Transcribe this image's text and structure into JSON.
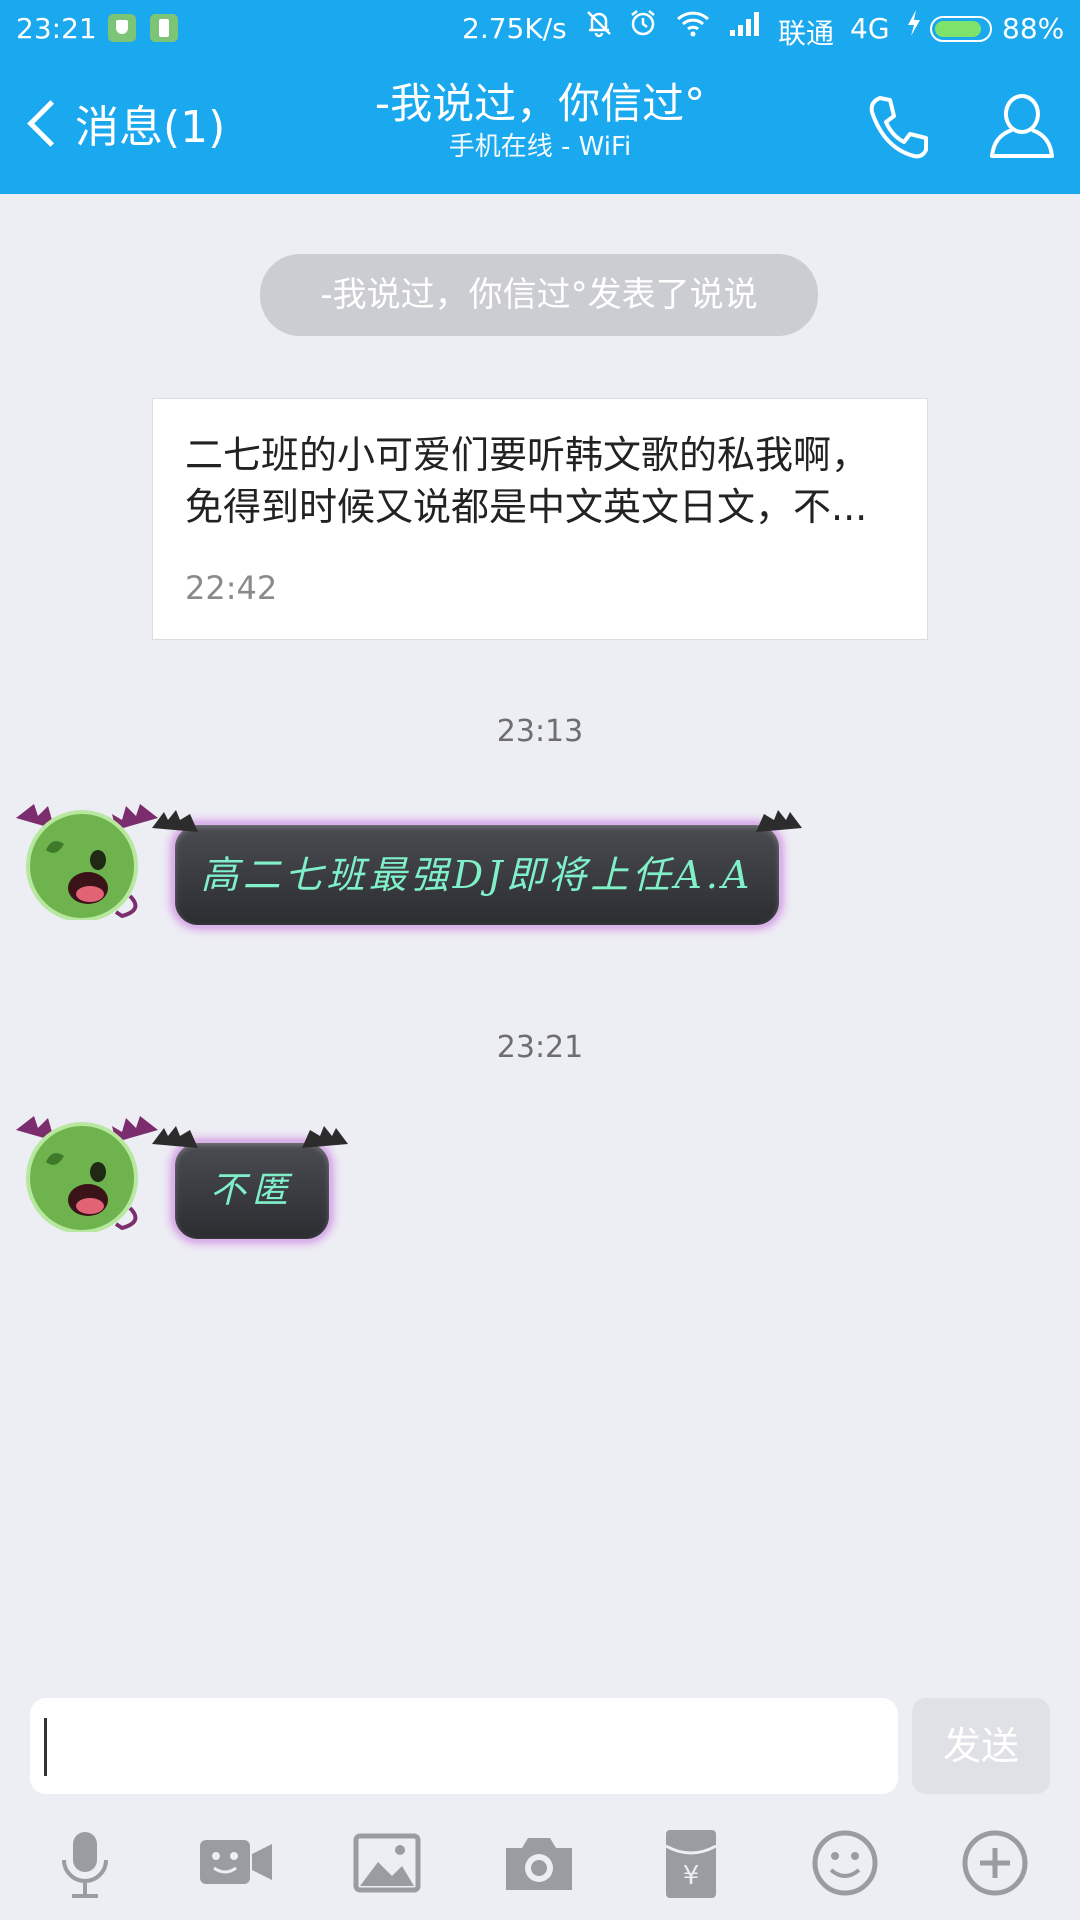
{
  "status_bar": {
    "time": "23:21",
    "net_speed": "2.75K/s",
    "carrier": "联通",
    "network": "4G",
    "battery_pct": "88%",
    "battery_level": 0.88,
    "icons": [
      "shield-icon",
      "battery-app-icon",
      "mute-bell-icon",
      "alarm-icon",
      "wifi-icon",
      "signal-icon",
      "charging-icon"
    ]
  },
  "header": {
    "back_label": "消息(1)",
    "title": "-我说过，你信过°",
    "subtitle": "手机在线 - WiFi",
    "accent_color": "#1aa8ee"
  },
  "chat": {
    "system_notice": "-我说过，你信过°发表了说说",
    "post": {
      "text": "二七班的小可爱们要听韩文歌的私我啊，免得到时候又说都是中文英文日文，不...",
      "time": "22:42"
    },
    "messages": [
      {
        "timestamp": "23:13",
        "text": "高二七班最强DJ即将上任A.A"
      },
      {
        "timestamp": "23:21",
        "text": "不匿"
      }
    ]
  },
  "input": {
    "value": "",
    "send_label": "发送"
  },
  "toolbar": [
    "microphone-icon",
    "video-call-icon",
    "image-icon",
    "camera-icon",
    "red-packet-icon",
    "emoji-icon",
    "plus-icon"
  ]
}
